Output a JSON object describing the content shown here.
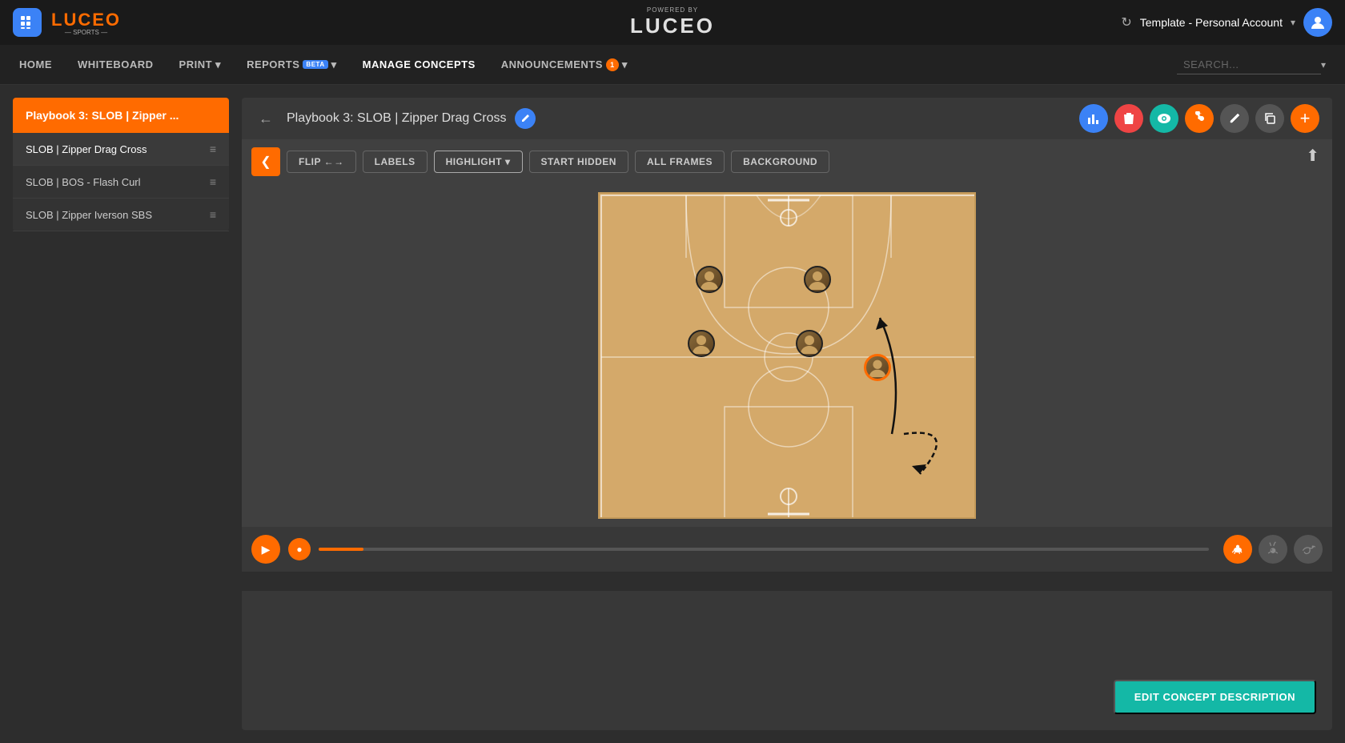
{
  "topbar": {
    "logo": "LUCEO",
    "logo_sub": "— SPORTS —",
    "powered_by": "POWERED BY",
    "center_logo": "LUCEO",
    "template_label": "Template - Personal Account",
    "refresh_title": "Refresh"
  },
  "nav": {
    "items": [
      {
        "id": "home",
        "label": "HOME",
        "active": false,
        "beta": false,
        "notif": 0
      },
      {
        "id": "whiteboard",
        "label": "WHITEBOARD",
        "active": false,
        "beta": false,
        "notif": 0
      },
      {
        "id": "print",
        "label": "PRINT",
        "active": false,
        "beta": false,
        "has_arrow": true,
        "notif": 0
      },
      {
        "id": "reports",
        "label": "REPORTS",
        "active": false,
        "beta": true,
        "has_arrow": true,
        "notif": 0
      },
      {
        "id": "manage-concepts",
        "label": "MANAGE CONCEPTS",
        "active": true,
        "beta": false,
        "notif": 0
      },
      {
        "id": "announcements",
        "label": "ANNOUNCEMENTS",
        "active": false,
        "beta": false,
        "has_arrow": true,
        "notif": 1
      }
    ],
    "search_placeholder": "SEARCH..."
  },
  "sidebar": {
    "playbook_title": "Playbook 3: SLOB | Zipper ...",
    "concepts": [
      {
        "id": "zipper-drag-cross",
        "label": "SLOB | Zipper Drag Cross",
        "active": true
      },
      {
        "id": "bos-flash-curl",
        "label": "SLOB | BOS - Flash Curl",
        "active": false
      },
      {
        "id": "zipper-iverson-sbs",
        "label": "SLOB | Zipper Iverson SBS",
        "active": false
      }
    ]
  },
  "content": {
    "back_label": "←",
    "title": "Playbook 3: SLOB | Zipper Drag Cross",
    "actions": [
      {
        "id": "stats",
        "icon": "📊",
        "color": "blue"
      },
      {
        "id": "delete",
        "icon": "🗑",
        "color": "red"
      },
      {
        "id": "view",
        "icon": "👁",
        "color": "teal"
      },
      {
        "id": "share",
        "icon": "🦊",
        "color": "orange"
      },
      {
        "id": "edit",
        "icon": "✏",
        "color": "gray"
      },
      {
        "id": "copy",
        "icon": "⧉",
        "color": "gray2"
      },
      {
        "id": "add",
        "icon": "+",
        "color": "orange"
      }
    ]
  },
  "toolbar": {
    "collapse_icon": "❮",
    "flip_label": "FLIP ←→",
    "labels_label": "LABELS",
    "highlight_label": "HIGHLIGHT",
    "start_hidden_label": "START HIDDEN",
    "all_frames_label": "ALL FRAMES",
    "background_label": "BACKGROUND"
  },
  "player_controls": {
    "play_icon": "▶",
    "step_icon": "●",
    "speed_icons": [
      "🐢",
      "🐇",
      "🐦"
    ]
  },
  "edit_button": {
    "label": "EDIT CONCEPT DESCRIPTION"
  }
}
